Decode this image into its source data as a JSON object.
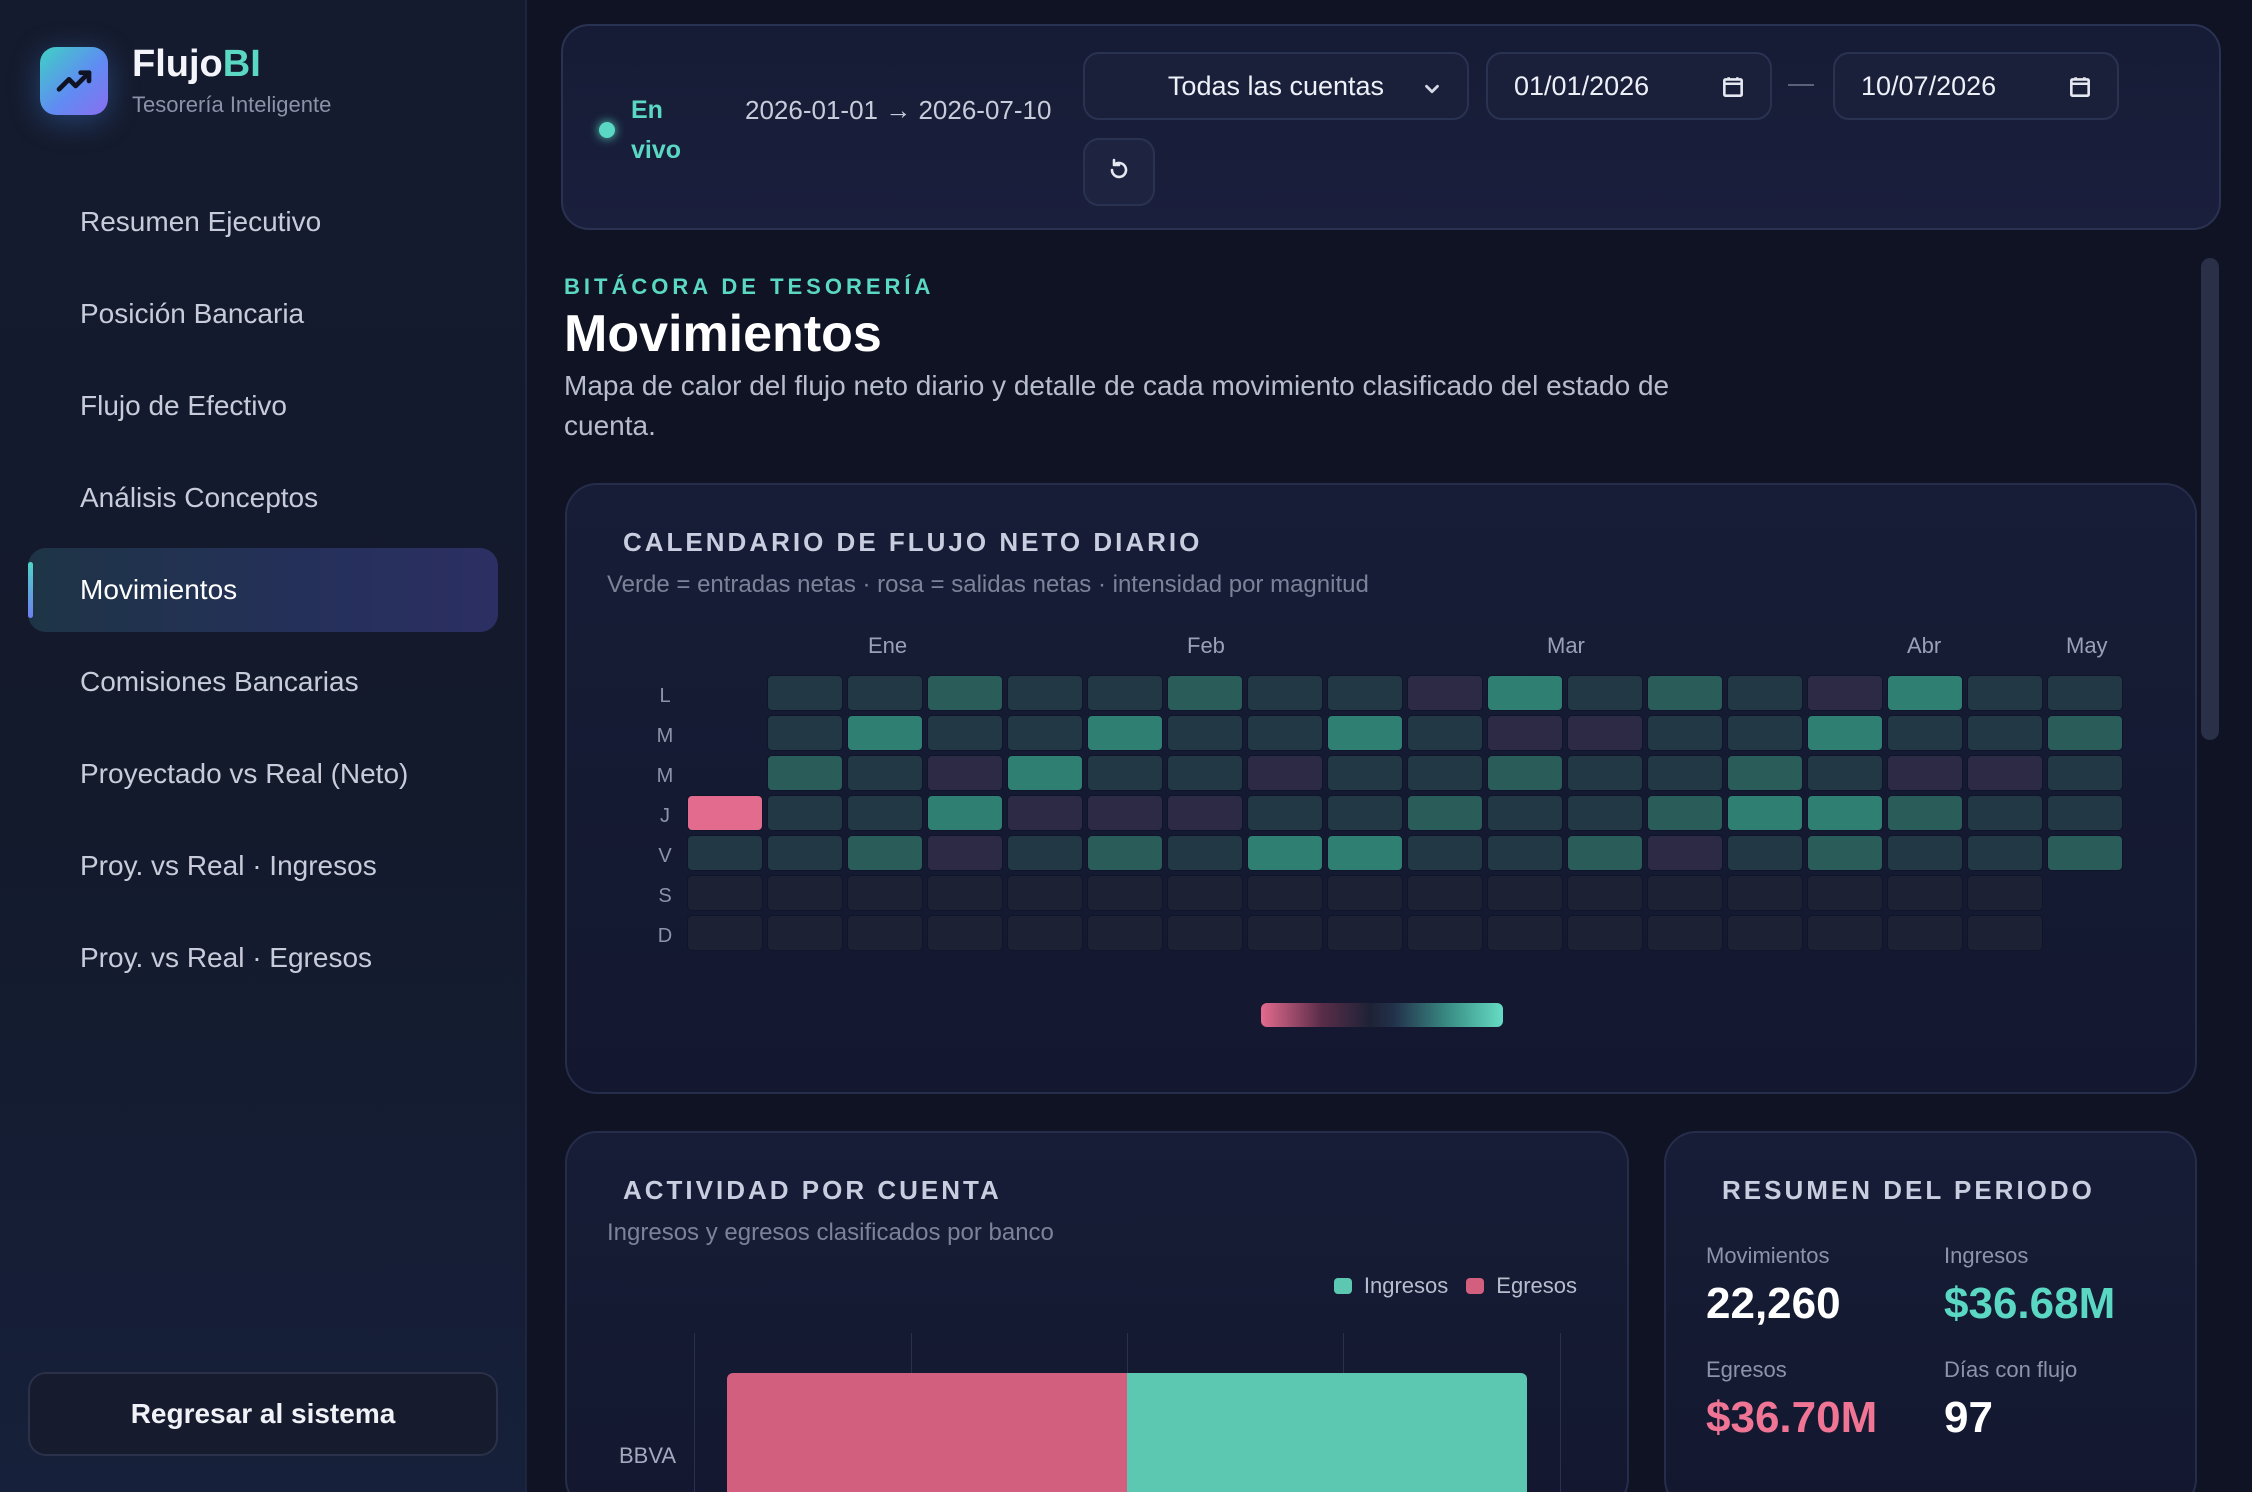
{
  "app": {
    "name_prefix": "Flujo",
    "name_accent": "BI",
    "subtitle": "Tesorería Inteligente"
  },
  "sidebar": {
    "items": [
      {
        "label": "Resumen Ejecutivo"
      },
      {
        "label": "Posición Bancaria"
      },
      {
        "label": "Flujo de Efectivo"
      },
      {
        "label": "Análisis Conceptos"
      },
      {
        "label": "Movimientos",
        "active": true
      },
      {
        "label": "Comisiones Bancarias"
      },
      {
        "label": "Proyectado vs Real (Neto)"
      },
      {
        "label": "Proy. vs Real · Ingresos"
      },
      {
        "label": "Proy. vs Real · Egresos"
      }
    ],
    "back_label": "Regresar al sistema"
  },
  "filters": {
    "live_label": "En vivo",
    "range_text": "2026-01-01 → 2026-07-10",
    "account_select": "Todas las cuentas",
    "date_from": "01/01/2026",
    "date_to": "10/07/2026"
  },
  "page": {
    "eyebrow": "BITÁCORA DE TESORERÍA",
    "title": "Movimientos",
    "description": "Mapa de calor del flujo neto diario y detalle de cada movimiento clasificado del estado de cuenta."
  },
  "heatmap": {
    "title": "CALENDARIO DE FLUJO NETO DIARIO",
    "subtitle": "Verde = entradas netas · rosa = salidas netas · intensidad por magnitud",
    "months": [
      "Ene",
      "Feb",
      "Mar",
      "Abr",
      "May"
    ],
    "days": [
      "L",
      "M",
      "M",
      "J",
      "V",
      "S",
      "D"
    ],
    "colors": {
      "pos_strong": "#2f7f72",
      "pos_mid": "#2a5c5a",
      "neutral_pos": "#223845",
      "neutral": "#262c44",
      "neg_light": "#2d2a46",
      "neg_strong": "#e36b8e",
      "weekend": "#1c2133"
    }
  },
  "activity": {
    "title": "ACTIVIDAD POR CUENTA",
    "subtitle": "Ingresos y egresos clasificados por banco",
    "legend": {
      "ingresos": "Ingresos",
      "egresos": "Egresos"
    },
    "colors": {
      "ingresos": "#5cc8b2",
      "egresos": "#d25f7d"
    },
    "chart_data": {
      "type": "bar",
      "categories": [
        "BBVA"
      ],
      "series": [
        {
          "name": "Egresos",
          "values": [
            36.7
          ]
        },
        {
          "name": "Ingresos",
          "values": [
            36.68
          ]
        }
      ]
    }
  },
  "summary": {
    "title": "RESUMEN DEL PERIODO",
    "movimientos_label": "Movimientos",
    "movimientos_value": "22,260",
    "ingresos_label": "Ingresos",
    "ingresos_value": "$36.68M",
    "egresos_label": "Egresos",
    "egresos_value": "$36.70M",
    "dias_label": "Días con flujo",
    "dias_value": "97",
    "colors": {
      "ingresos": "#5ad8c3",
      "egresos": "#f07595"
    }
  }
}
